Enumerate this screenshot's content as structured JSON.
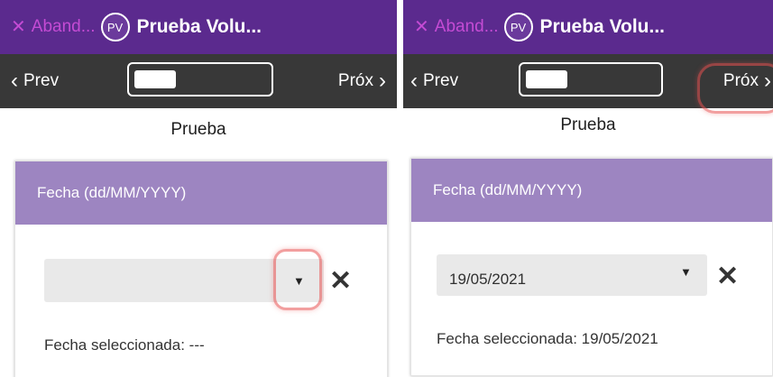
{
  "left": {
    "header": {
      "abandon_label": "Aband...",
      "avatar_initials": "PV",
      "title": "Prueba Volu..."
    },
    "nav": {
      "prev_label": "Prev",
      "next_label": "Próx"
    },
    "page_title": "Prueba",
    "question": {
      "label": "Fecha (dd/MM/YYYY)",
      "date_value": "",
      "selected_text": "Fecha seleccionada: ---"
    }
  },
  "right": {
    "header": {
      "abandon_label": "Aband...",
      "avatar_initials": "PV",
      "title": "Prueba Volu..."
    },
    "nav": {
      "prev_label": "Prev",
      "next_label": "Próx"
    },
    "page_title": "Prueba",
    "question": {
      "label": "Fecha (dd/MM/YYYY)",
      "date_value": "19/05/2021",
      "selected_text": "Fecha seleccionada: 19/05/2021"
    }
  },
  "colors": {
    "header_bg": "#5b2a8e",
    "nav_bg": "#383838",
    "abandon_text": "#c44bd4",
    "card_header_bg": "#9d85c1",
    "select_bg": "#e9e9e9",
    "highlight": "#e85050"
  }
}
